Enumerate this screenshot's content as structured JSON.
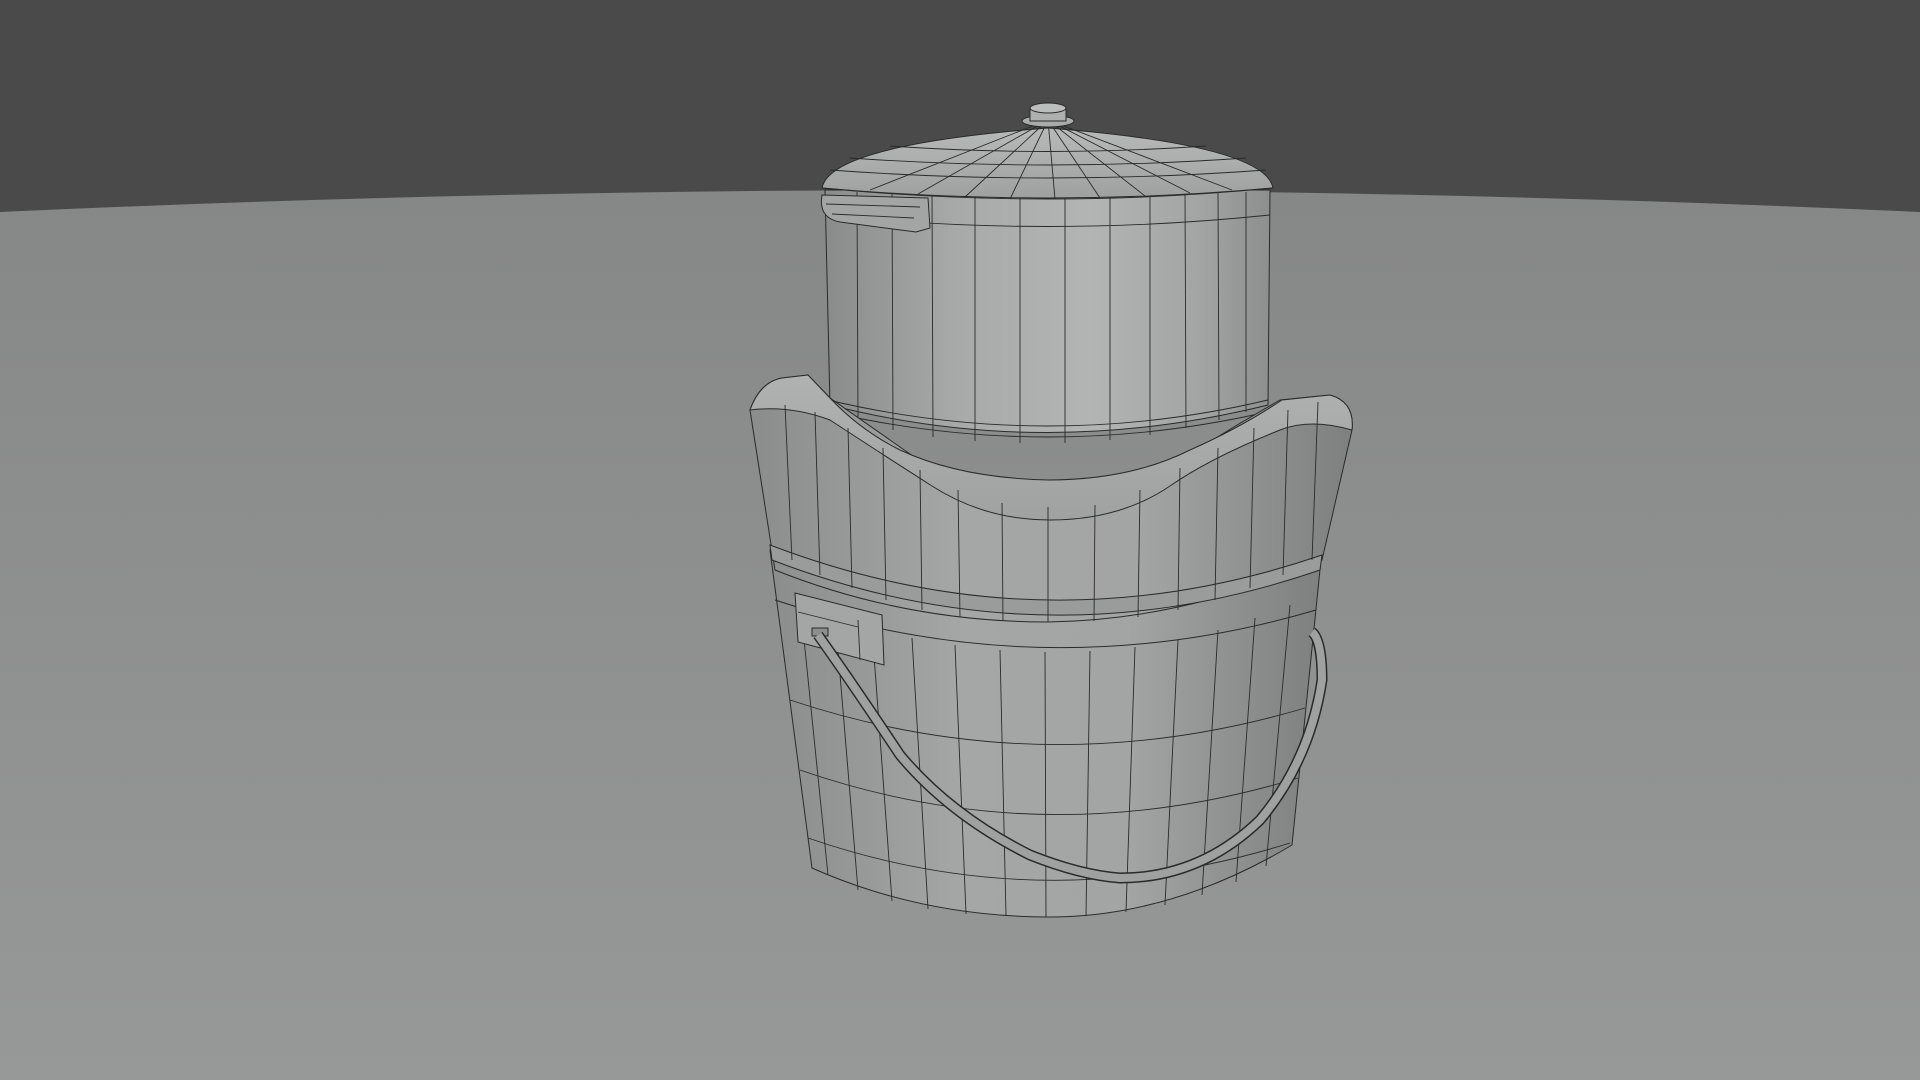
{
  "scene": {
    "background_color": "#4a4a4a",
    "floor_color": "#8e8f8f",
    "object_color": "#9c9d9d",
    "wire_color": "#2a2a2a",
    "objects": [
      {
        "name": "cooking-pot",
        "parts": [
          "pot-body",
          "pot-lid",
          "lid-knob",
          "side-handle"
        ]
      },
      {
        "name": "wooden-bucket",
        "parts": [
          "bucket-upper-tub",
          "bucket-lower-tub",
          "metal-band",
          "handle-bracket",
          "wire-handle"
        ]
      }
    ]
  }
}
